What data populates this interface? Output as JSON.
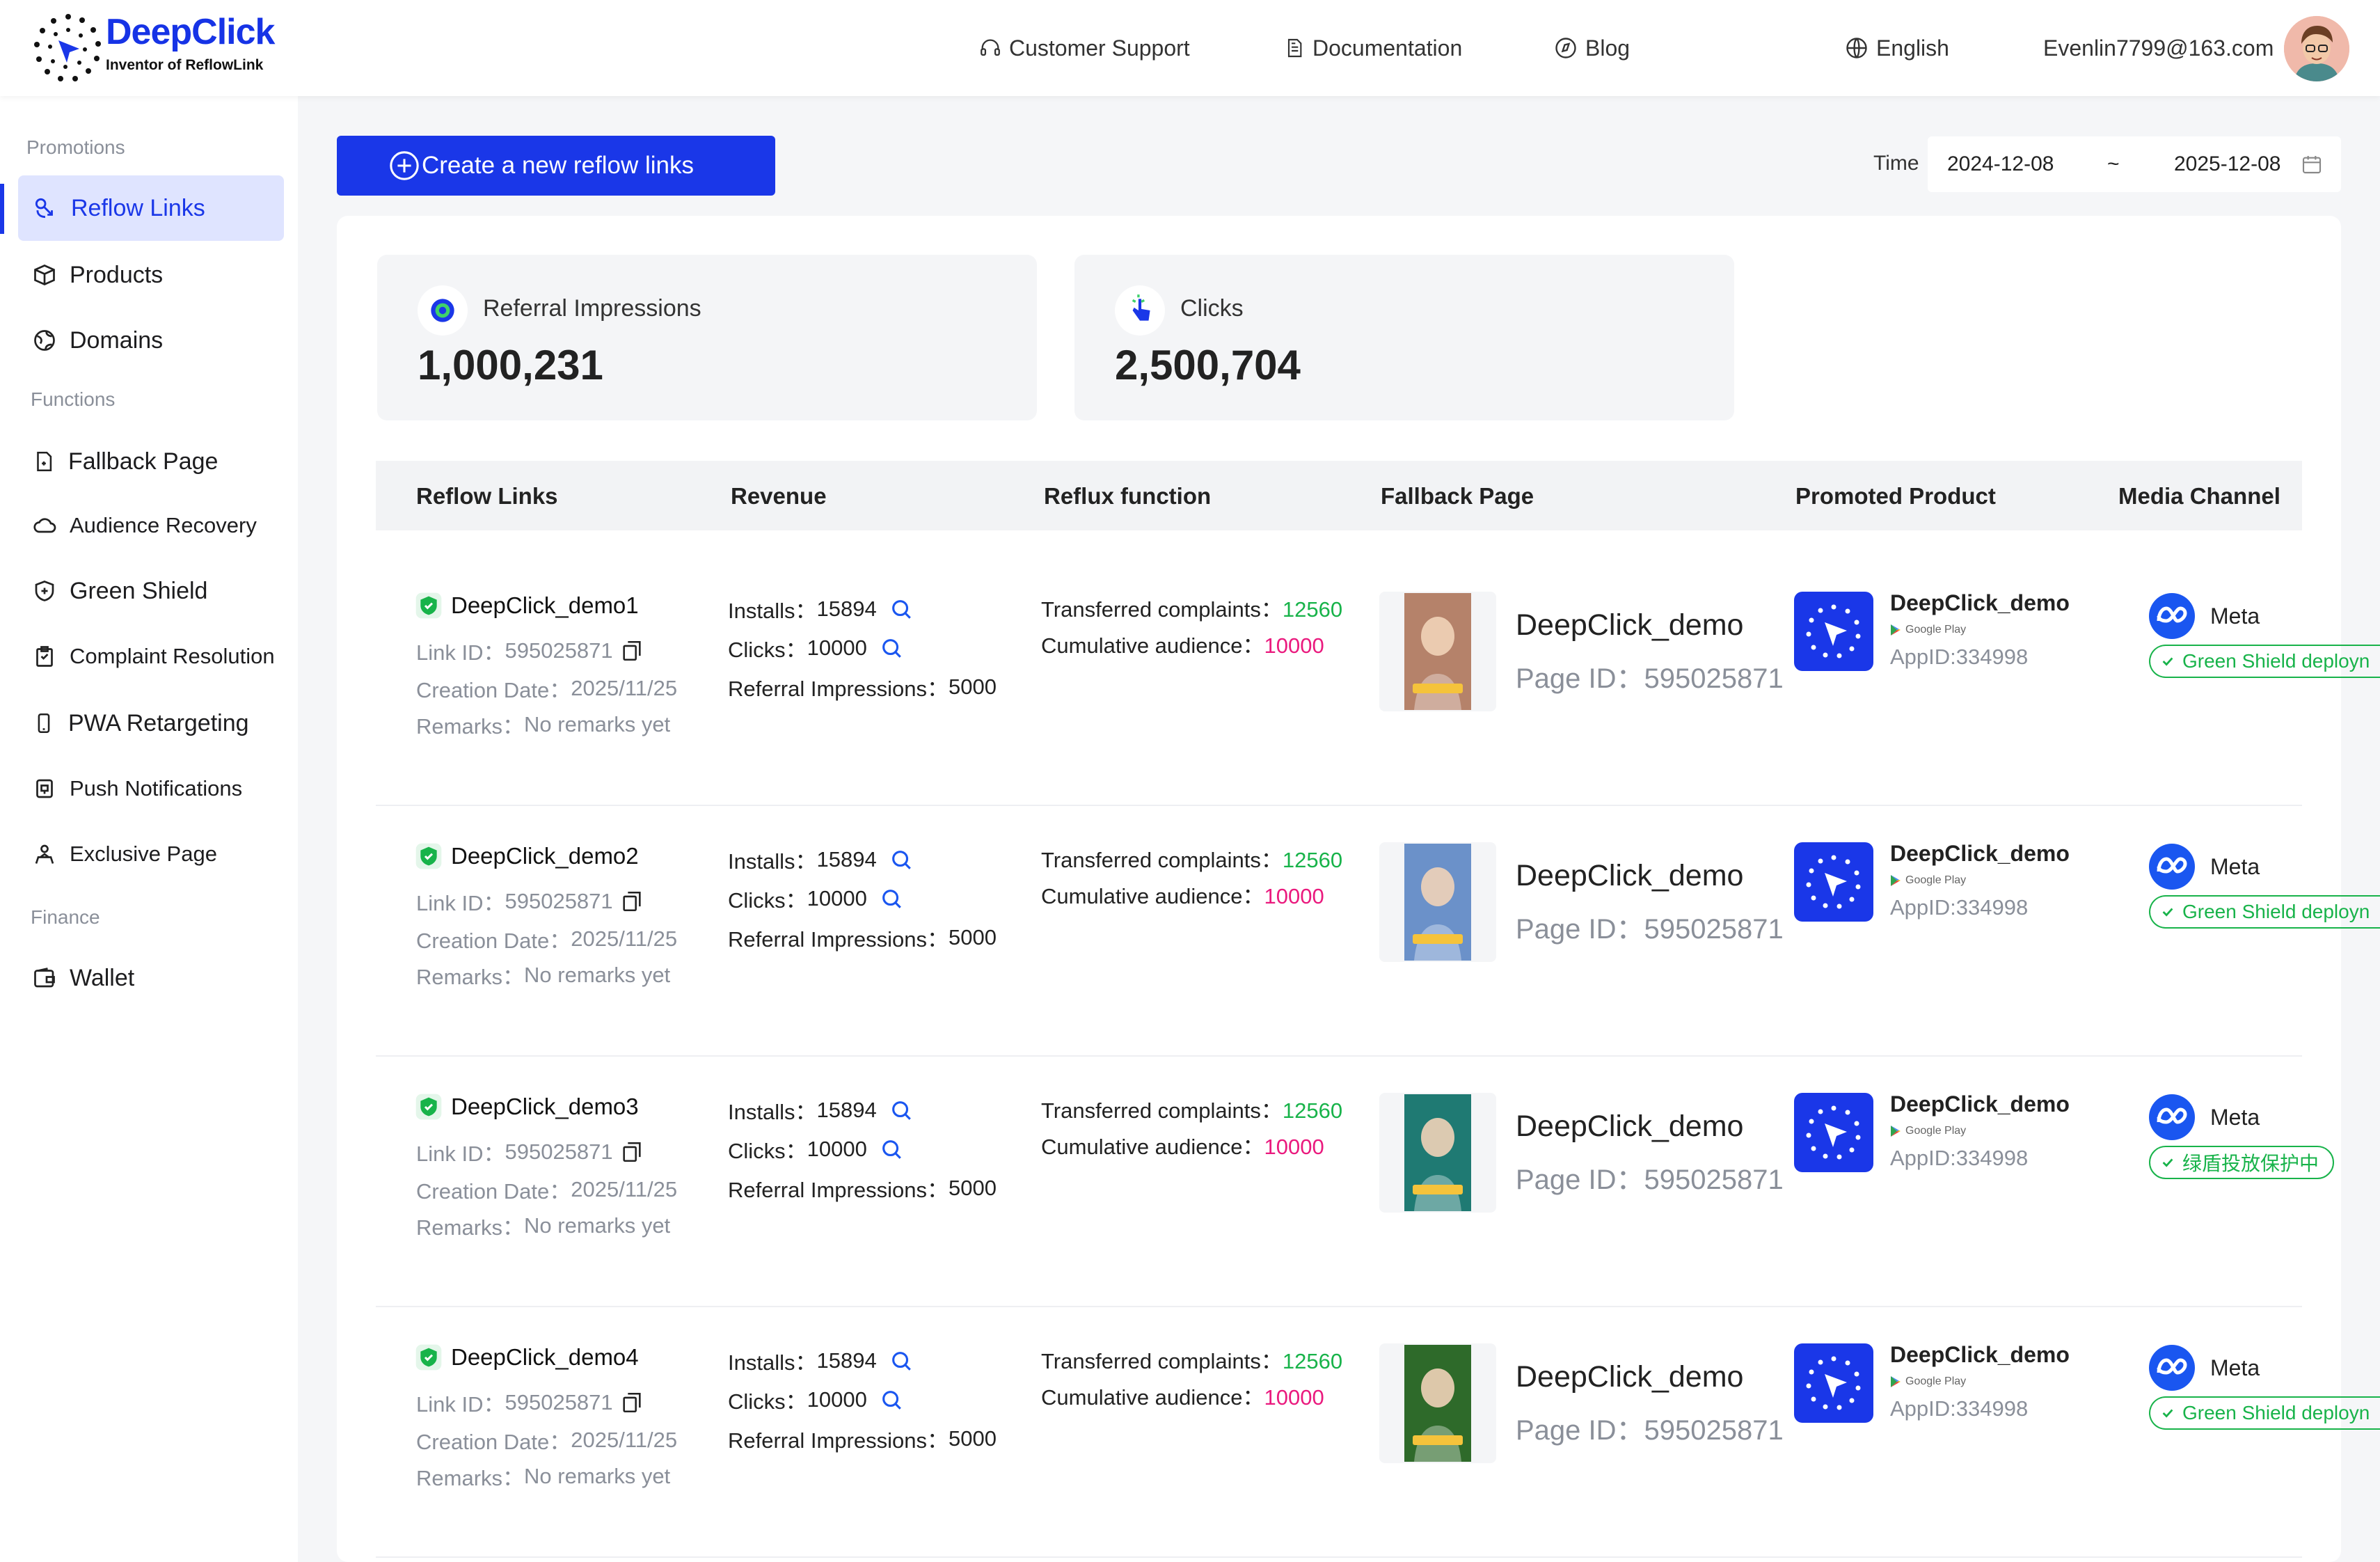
{
  "brand": {
    "name": "DeepClick",
    "tagline": "Inventor of ReflowLink"
  },
  "nav": {
    "support": "Customer Support",
    "docs": "Documentation",
    "blog": "Blog",
    "language": "English",
    "user_email": "Evenlin7799@163.com"
  },
  "sidebar": {
    "sections": [
      "Promotions",
      "Functions",
      "Finance"
    ],
    "items": [
      {
        "label": "Reflow Links",
        "icon": "link-icon",
        "active": true
      },
      {
        "label": "Products",
        "icon": "box-icon"
      },
      {
        "label": "Domains",
        "icon": "globe-icon"
      },
      {
        "label": "Fallback Page",
        "icon": "page-icon"
      },
      {
        "label": "Audience Recovery",
        "icon": "cloud-icon"
      },
      {
        "label": "Green Shield",
        "icon": "shield-icon"
      },
      {
        "label": "Complaint Resolution",
        "icon": "clipboard-icon"
      },
      {
        "label": "PWA Retargeting",
        "icon": "phone-icon"
      },
      {
        "label": "Push Notifications",
        "icon": "bell-icon"
      },
      {
        "label": "Exclusive Page",
        "icon": "person-icon"
      },
      {
        "label": "Wallet",
        "icon": "wallet-icon"
      }
    ]
  },
  "toolbar": {
    "create_label": "Create a new reflow links",
    "time_label": "Time",
    "date_start": "2024-12-08",
    "date_sep": "~",
    "date_end": "2025-12-08"
  },
  "stats": [
    {
      "label": "Referral Impressions",
      "value": "1,000,231"
    },
    {
      "label": "Clicks",
      "value": "2,500,704"
    }
  ],
  "table": {
    "headers": [
      "Reflow Links",
      "Revenue",
      "Reflux function",
      "Fallback Page",
      "Promoted Product",
      "Media Channel"
    ],
    "labels": {
      "link_id": "Link ID：",
      "creation": "Creation Date：",
      "remarks": "Remarks：",
      "installs": "Installs：",
      "clicks": "Clicks：",
      "impr": "Referral Impressions：",
      "complaints": "Transferred complaints：",
      "audience": "Cumulative audience：",
      "page_id": "Page ID：",
      "google_play": "Google Play"
    },
    "rows": [
      {
        "name": "DeepClick_demo1",
        "link_id": "595025871",
        "date": "2025/11/25",
        "remarks": "No remarks yet",
        "installs": "15894",
        "clicks": "10000",
        "impr": "5000",
        "complaints": "12560",
        "audience": "10000",
        "fb_name": "DeepClick_demo",
        "fb_id": "595025871",
        "product": "DeepClick_demo",
        "app_id": "AppID:334998",
        "channel": "Meta",
        "badge": "Green Shield deployn",
        "thumb_color": "#b5826a"
      },
      {
        "name": "DeepClick_demo2",
        "link_id": "595025871",
        "date": "2025/11/25",
        "remarks": "No remarks yet",
        "installs": "15894",
        "clicks": "10000",
        "impr": "5000",
        "complaints": "12560",
        "audience": "10000",
        "fb_name": "DeepClick_demo",
        "fb_id": "595025871",
        "product": "DeepClick_demo",
        "app_id": "AppID:334998",
        "channel": "Meta",
        "badge": "Green Shield deployn",
        "thumb_color": "#6b91c9"
      },
      {
        "name": "DeepClick_demo3",
        "link_id": "595025871",
        "date": "2025/11/25",
        "remarks": "No remarks yet",
        "installs": "15894",
        "clicks": "10000",
        "impr": "5000",
        "complaints": "12560",
        "audience": "10000",
        "fb_name": "DeepClick_demo",
        "fb_id": "595025871",
        "product": "DeepClick_demo",
        "app_id": "AppID:334998",
        "channel": "Meta",
        "badge": "绿盾投放保护中",
        "thumb_color": "#1f7a73"
      },
      {
        "name": "DeepClick_demo4",
        "link_id": "595025871",
        "date": "2025/11/25",
        "remarks": "No remarks yet",
        "installs": "15894",
        "clicks": "10000",
        "impr": "5000",
        "complaints": "12560",
        "audience": "10000",
        "fb_name": "DeepClick_demo",
        "fb_id": "595025871",
        "product": "DeepClick_demo",
        "app_id": "AppID:334998",
        "channel": "Meta",
        "badge": "Green Shield deployn",
        "thumb_color": "#2e6a2a"
      }
    ]
  },
  "colors": {
    "accent": "#1a37e8",
    "success": "#18b34a",
    "highlight": "#ea1a7e"
  }
}
